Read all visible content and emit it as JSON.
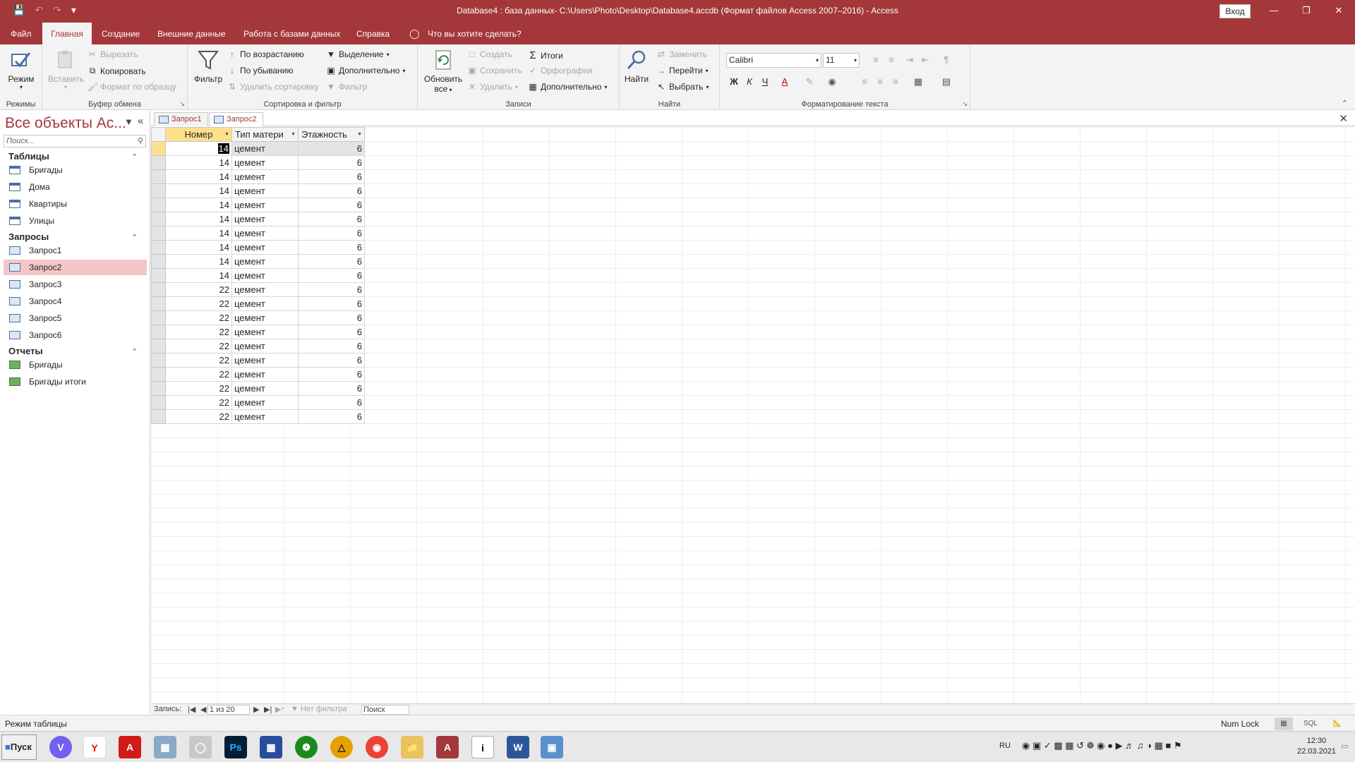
{
  "window": {
    "title": "Database4 : база данных- C:\\Users\\Photo\\Desktop\\Database4.accdb (Формат файлов Access 2007–2016)  -  Access",
    "signin": "Вход"
  },
  "menu": {
    "tabs": [
      "Файл",
      "Главная",
      "Создание",
      "Внешние данные",
      "Работа с базами данных",
      "Справка"
    ],
    "active": "Главная",
    "tellme": "Что вы хотите сделать?"
  },
  "ribbon": {
    "modes": {
      "label": "Режим",
      "group": "Режимы"
    },
    "clipboard": {
      "paste": "Вставить",
      "cut": "Вырезать",
      "copy": "Копировать",
      "format_painter": "Формат по образцу",
      "group": "Буфер обмена"
    },
    "sort_filter": {
      "filter": "Фильтр",
      "asc": "По возрастанию",
      "desc": "По убыванию",
      "remove_sort": "Удалить сортировку",
      "selection": "Выделение",
      "advanced": "Дополнительно",
      "toggle_filter": "Фильтр",
      "group": "Сортировка и фильтр"
    },
    "records": {
      "refresh_line1": "Обновить",
      "refresh_line2": "все",
      "new": "Создать",
      "save": "Сохранить",
      "delete": "Удалить",
      "totals": "Итоги",
      "spelling": "Орфография",
      "more": "Дополнительно",
      "group": "Записи"
    },
    "find": {
      "find": "Найти",
      "replace": "Заменить",
      "goto": "Перейти",
      "select": "Выбрать",
      "group": "Найти"
    },
    "text_format": {
      "font": "Calibri",
      "size": "11",
      "bold": "Ж",
      "italic": "К",
      "underline": "Ч",
      "group": "Форматирование текста"
    }
  },
  "nav": {
    "header": "Все объекты Ас...",
    "search_placeholder": "Поиск...",
    "categories": [
      {
        "name": "Таблицы",
        "items": [
          "Бригады",
          "Дома",
          "Квартиры",
          "Улицы"
        ]
      },
      {
        "name": "Запросы",
        "items": [
          "Запрос1",
          "Запрос2",
          "Запрос3",
          "Запрос4",
          "Запрос5",
          "Запрос6"
        ]
      },
      {
        "name": "Отчеты",
        "items": [
          "Бригады",
          "Бригады итоги"
        ]
      }
    ],
    "selected": "Запрос2"
  },
  "doc_tabs": [
    "Запрос1",
    "Запрос2"
  ],
  "active_doc": "Запрос2",
  "grid": {
    "columns": [
      "Номер",
      "Тип матери",
      "Этажность"
    ],
    "rows": [
      [
        "14",
        "цемент",
        "6"
      ],
      [
        "14",
        "цемент",
        "6"
      ],
      [
        "14",
        "цемент",
        "6"
      ],
      [
        "14",
        "цемент",
        "6"
      ],
      [
        "14",
        "цемент",
        "6"
      ],
      [
        "14",
        "цемент",
        "6"
      ],
      [
        "14",
        "цемент",
        "6"
      ],
      [
        "14",
        "цемент",
        "6"
      ],
      [
        "14",
        "цемент",
        "6"
      ],
      [
        "14",
        "цемент",
        "6"
      ],
      [
        "22",
        "цемент",
        "6"
      ],
      [
        "22",
        "цемент",
        "6"
      ],
      [
        "22",
        "цемент",
        "6"
      ],
      [
        "22",
        "цемент",
        "6"
      ],
      [
        "22",
        "цемент",
        "6"
      ],
      [
        "22",
        "цемент",
        "6"
      ],
      [
        "22",
        "цемент",
        "6"
      ],
      [
        "22",
        "цемент",
        "6"
      ],
      [
        "22",
        "цемент",
        "6"
      ],
      [
        "22",
        "цемент",
        "6"
      ]
    ]
  },
  "record_nav": {
    "label": "Запись:",
    "position": "1 из 20",
    "filter": "Нет фильтра",
    "search": "Поиск"
  },
  "status": {
    "mode": "Режим таблицы",
    "numlock": "Num Lock",
    "sql": "SQL"
  },
  "taskbar": {
    "start": "Пуск",
    "lang": "RU",
    "time": "12:30",
    "date": "22.03.2021"
  },
  "colors": {
    "accent": "#a4373a",
    "selection": "#f5c6c7",
    "header_highlight": "#fde08c"
  }
}
